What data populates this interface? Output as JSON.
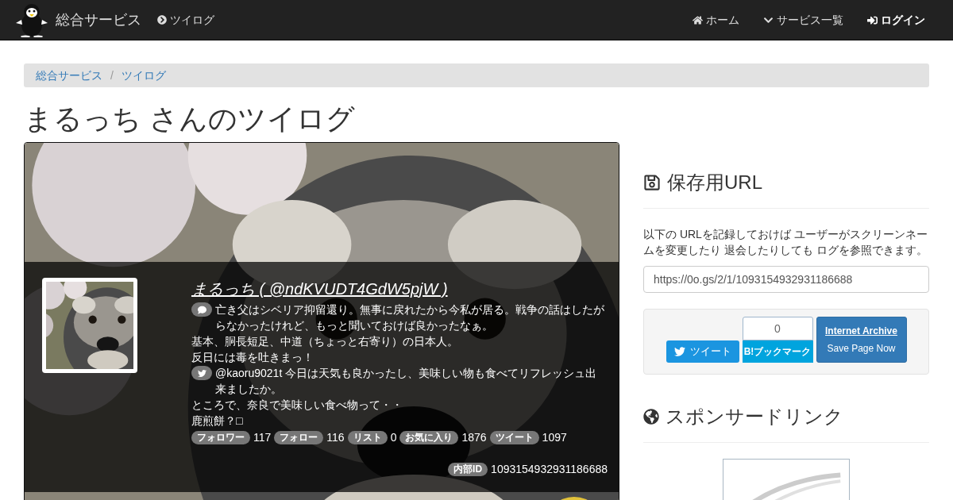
{
  "navbar": {
    "brand": "総合サービス",
    "section_link": "ツイログ",
    "items": [
      {
        "kind": "home",
        "label": "ホーム"
      },
      {
        "kind": "services",
        "label": "サービス一覧"
      },
      {
        "kind": "login",
        "label": "ログイン"
      }
    ]
  },
  "breadcrumb": [
    "総合サービス",
    "ツイログ"
  ],
  "breadcrumb_separator": "/",
  "page_title": "まるっち さんのツイログ",
  "profile": {
    "name_link": "まるっち ( @ndKVUDT4GdW5pjW )",
    "description_lines": [
      "亡き父はシベリア抑留還り。無事に戻れたから今私が居る。戦争の話はしたがらなかったけれど、もっと聞いておけば良かったなぁ。",
      "基本、胴長短足、中道（ちょっと右寄り）の日本人。",
      "反日には毒を吐きまっ！"
    ],
    "latest_tweet_lines": [
      "@kaoru9021t 今日は天気も良かったし、美味しい物も食べてリフレッシュ出来ましたか。",
      "ところで、奈良で美味しい食べ物って・・",
      "鹿煎餅？□"
    ],
    "stats": [
      {
        "label": "フォロワー",
        "value": "117"
      },
      {
        "label": "フォロー",
        "value": "116"
      },
      {
        "label": "リスト",
        "value": "0"
      },
      {
        "label": "お気に入り",
        "value": "1876"
      },
      {
        "label": "ツイート",
        "value": "1097"
      }
    ],
    "internal_id": {
      "label": "内部ID",
      "value": "1093154932931186688"
    }
  },
  "save_url": {
    "heading": "保存用URL",
    "description": "以下の URLを記録しておけば ユーザーがスクリーンネームを変更したり 退会したりしても ログを参照できます。",
    "url": "https://0o.gs/2/1/1093154932931186688",
    "tweet_button": "ツイート",
    "bookmark_count": "0",
    "bookmark_button": "B!ブックマーク",
    "archive_title": "Internet Archive",
    "archive_action": "Save Page Now"
  },
  "sponsored": {
    "heading": "スポンサードリンク"
  }
}
